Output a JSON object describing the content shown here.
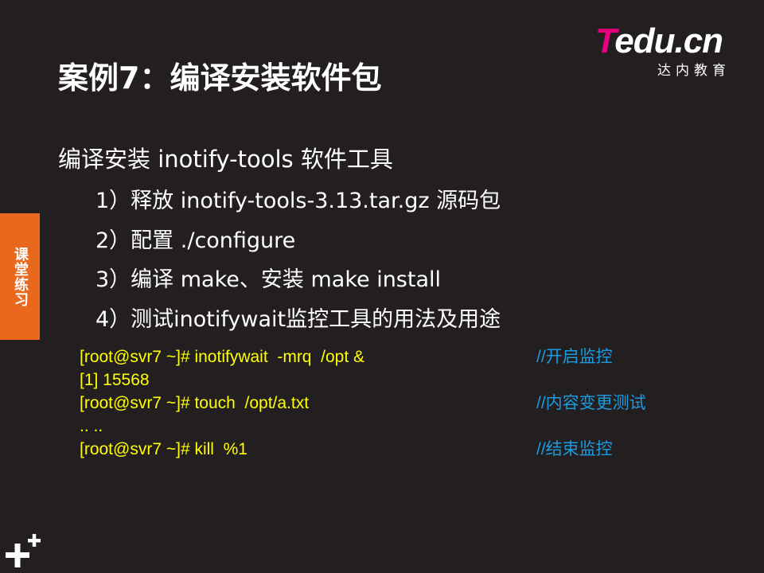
{
  "brand": {
    "logo_initial": "T",
    "logo_rest": "edu.cn",
    "subtitle": "达内教育",
    "color_pink": "#e6007e"
  },
  "title": "案例7：编译安装软件包",
  "side_tab": "课堂练习",
  "bullet": "编译安装 inotify-tools 软件工具",
  "steps": [
    "1）释放 inotify-tools-3.13.tar.gz 源码包",
    "2）配置 ./configure",
    "3）编译 make、安装 make install",
    "4）测试inotifywait监控工具的用法及用途"
  ],
  "code": [
    {
      "cmd": "[root@svr7 ~]# inotifywait  -mrq  /opt &",
      "comment": "//开启监控"
    },
    {
      "cmd": "[1] 15568",
      "comment": ""
    },
    {
      "cmd": "[root@svr7 ~]# touch  /opt/a.txt",
      "comment": "//内容变更测试"
    },
    {
      "cmd": ".. ..",
      "comment": ""
    },
    {
      "cmd": "[root@svr7 ~]# kill  %1",
      "comment": "//结束监控"
    }
  ],
  "colors": {
    "background": "#231f20",
    "accent_orange": "#e9681b",
    "code_yellow": "#ffff00",
    "comment_blue": "#1b9be0"
  },
  "icons": {
    "corner": "plus-icon"
  }
}
